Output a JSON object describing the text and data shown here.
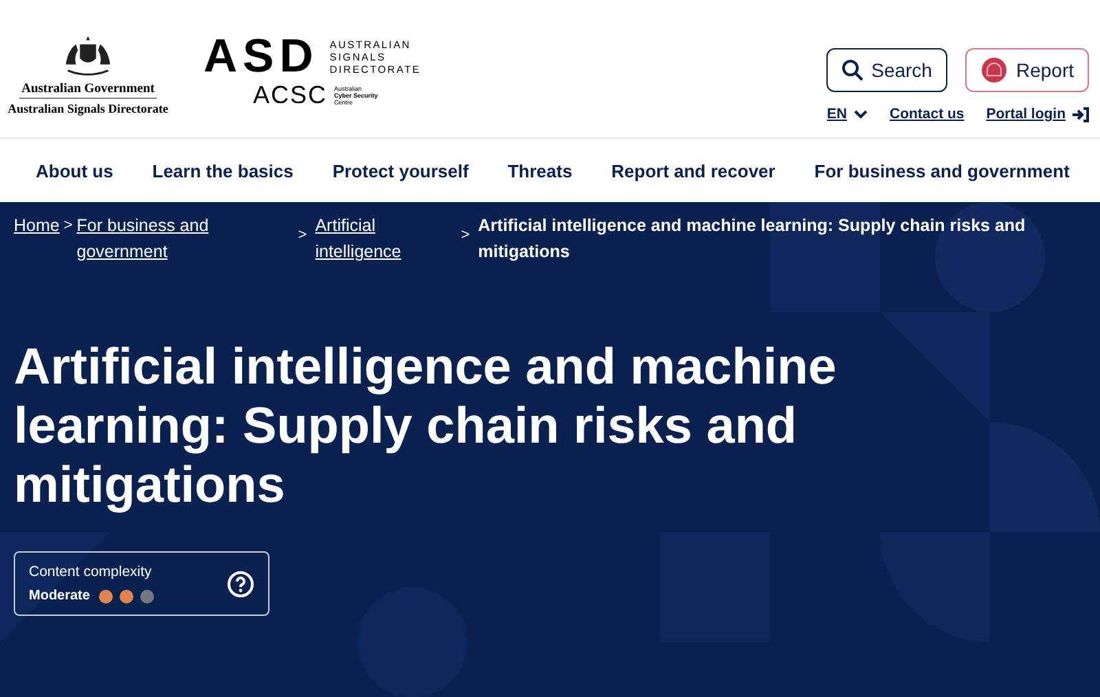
{
  "header": {
    "government_logo": {
      "line_1": "Australian Government",
      "line_2": "Australian Signals Directorate"
    },
    "asd_logo": {
      "mark": "ASD",
      "name_lines": [
        "AUSTRALIAN",
        "SIGNALS",
        "DIRECTORATE"
      ]
    },
    "acsc_logo": {
      "mark": "ACSC",
      "name_lines": [
        "Australian",
        "Cyber Security",
        "Centre"
      ]
    },
    "search_button": "Search",
    "report_button": "Report",
    "utility_links": [
      {
        "label": "EN",
        "kind": "language"
      },
      {
        "label": "Contact us",
        "kind": "link"
      },
      {
        "label": "Portal login",
        "kind": "login"
      }
    ]
  },
  "nav": {
    "items": [
      "About us",
      "Learn the basics",
      "Protect yourself",
      "Threats",
      "Report and recover",
      "For business and government"
    ]
  },
  "breadcrumb": [
    {
      "label": "Home",
      "kind": "link",
      "separator": ">"
    },
    {
      "label": "For business and government",
      "kind": "link",
      "separator": ">"
    },
    {
      "label": "Artificial intelligence",
      "kind": "link",
      "separator": ">"
    },
    {
      "label": "Artificial intelligence and machine learning: Supply chain risks and mitigations",
      "kind": "current"
    }
  ],
  "title": "Artificial intelligence and machine learning: Supply chain risks and mitigations",
  "complexity": {
    "label": "Content complexity",
    "value": "Moderate",
    "dots": [
      {
        "filled": true
      },
      {
        "filled": true
      },
      {
        "filled": false
      }
    ]
  }
}
